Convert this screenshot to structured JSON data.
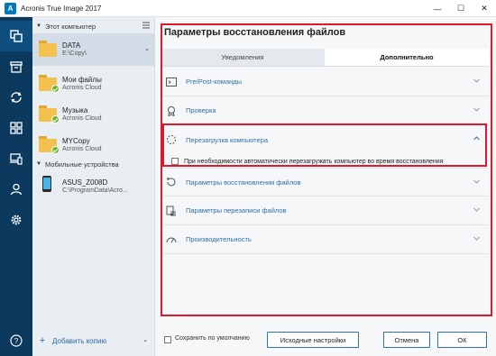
{
  "window": {
    "title": "Acronis True Image 2017",
    "logo_letter": "A",
    "minimize": "—",
    "maximize": "☐",
    "close": "✕"
  },
  "rail": {
    "items": [
      {
        "name": "backup",
        "active": true
      },
      {
        "name": "archive",
        "active": false
      },
      {
        "name": "sync",
        "active": false
      },
      {
        "name": "dashboard",
        "active": false
      },
      {
        "name": "devices",
        "active": false
      },
      {
        "name": "account",
        "active": false
      },
      {
        "name": "settings",
        "active": false
      },
      {
        "name": "help",
        "active": false
      }
    ]
  },
  "sources": {
    "computer_section": "Этот компьютер",
    "items": [
      {
        "name": "DATA",
        "sub": "E:\\Copy\\",
        "type": "folder",
        "selected": true,
        "badge": false
      },
      {
        "name": "Мои файлы",
        "sub": "Acronis Cloud",
        "type": "folder",
        "selected": false,
        "badge": true
      },
      {
        "name": "Музыка",
        "sub": "Acronis Cloud",
        "type": "folder",
        "selected": false,
        "badge": true
      },
      {
        "name": "MYCopy",
        "sub": "Acronis Cloud",
        "type": "folder",
        "selected": false,
        "badge": true
      }
    ],
    "mobile_section": "Мобильные устройства",
    "mobile_item": {
      "name": "ASUS_Z008D",
      "sub": "C:\\ProgramData\\Acro..."
    },
    "add_copy": "Добавить копию",
    "add_plus": "+",
    "chevron": "⌄",
    "section_arrow": "▼"
  },
  "dialog": {
    "title": "Параметры восстановления файлов",
    "tabs": [
      {
        "label": "Уведомления",
        "active": false
      },
      {
        "label": "Дополнительно",
        "active": true
      }
    ],
    "options": [
      {
        "label": "Pre/Post-команды",
        "icon": "terminal-icon",
        "expanded": false
      },
      {
        "label": "Проверка",
        "icon": "badge-icon",
        "expanded": false
      },
      {
        "label": "Перезагрузка компьютера",
        "icon": "restart-icon",
        "expanded": true
      },
      {
        "label": "Параметры восстановления файлов",
        "icon": "restore-icon",
        "expanded": false
      },
      {
        "label": "Параметры перезаписи файлов",
        "icon": "overwrite-icon",
        "expanded": false
      },
      {
        "label": "Производительность",
        "icon": "gauge-icon",
        "expanded": false
      }
    ],
    "restart_checkbox": "При необходимости автоматически перезагружать компьютер во время восстановления",
    "save_default": "Сохранить по умолчанию",
    "reset_button": "Исходные настройки",
    "cancel_button": "Отмена",
    "ok_button": "ОК"
  },
  "colors": {
    "rail_bg": "#0b3a5e",
    "accent_link": "#2f6fa7",
    "highlight_red": "#e0182d",
    "folder": "#f2c14e",
    "ok_badge": "#6bb42d"
  }
}
